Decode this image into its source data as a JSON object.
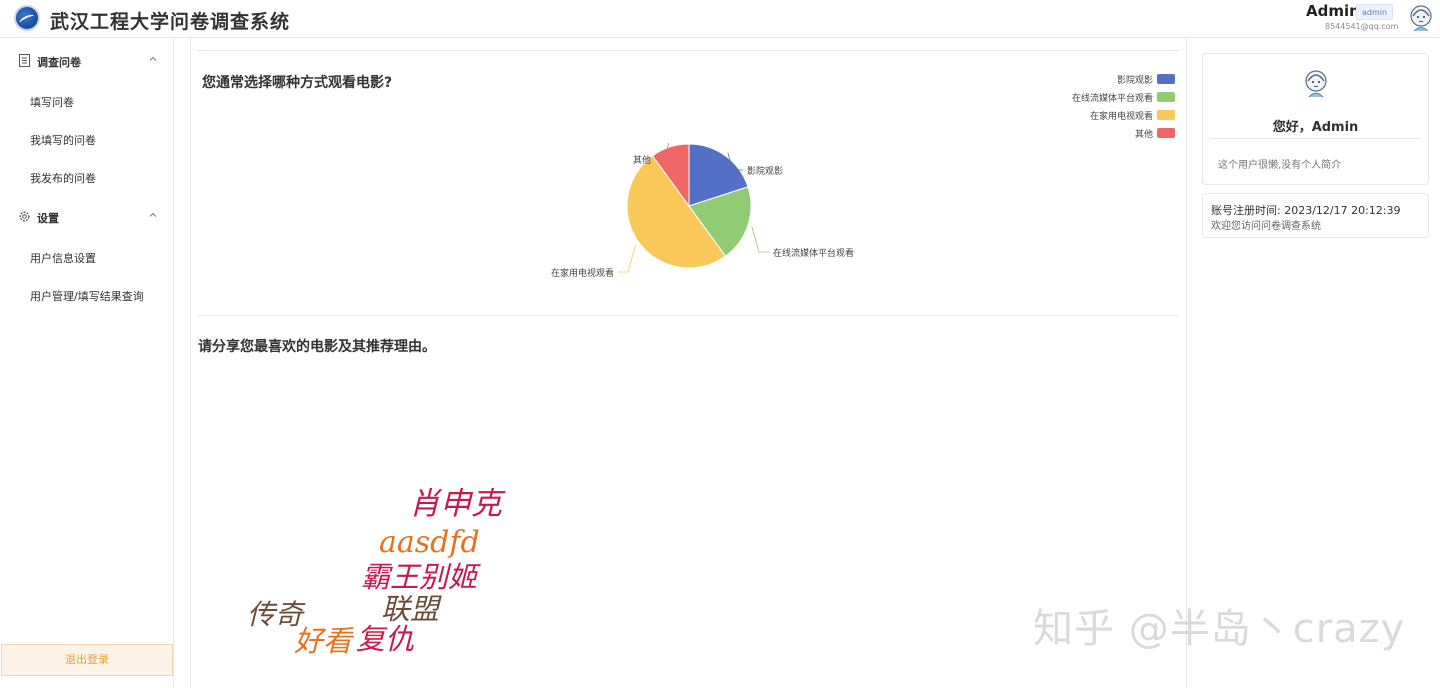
{
  "header": {
    "title": "武汉工程大学问卷调查系统",
    "user_name": "Admin",
    "user_role": "admin",
    "user_email": "8544541@qq.com"
  },
  "sidebar": {
    "groups": [
      {
        "label": "调查问卷",
        "icon": "document-icon",
        "items": [
          "填写问卷",
          "我填写的问卷",
          "我发布的问卷"
        ]
      },
      {
        "label": "设置",
        "icon": "gear-icon",
        "items": [
          "用户信息设置",
          "用户管理/填写结果查询"
        ]
      }
    ],
    "logout_label": "退出登录"
  },
  "main": {
    "q1_title": "您通常选择哪种方式观看电影?",
    "q2_title": "请分享您最喜欢的电影及其推荐理由。"
  },
  "chart_data": {
    "type": "pie",
    "categories": [
      "影院观影",
      "在线流媒体平台观看",
      "在家用电视观看",
      "其他"
    ],
    "values": [
      20,
      20,
      50,
      10
    ],
    "colors": [
      "#5470c6",
      "#91cc75",
      "#fac858",
      "#ee6666"
    ],
    "legend_position": "top-right"
  },
  "word_cloud": [
    {
      "text": "肖申克",
      "color": "#c9184a"
    },
    {
      "text": "aasdfd",
      "color": "#e8711c"
    },
    {
      "text": "霸王别姬",
      "color": "#c9184a"
    },
    {
      "text": "联盟",
      "color": "#6b4e3a"
    },
    {
      "text": "传奇",
      "color": "#6b4e3a"
    },
    {
      "text": "好看",
      "color": "#e8711c"
    },
    {
      "text": "复仇",
      "color": "#c9184a"
    }
  ],
  "profile": {
    "greeting": "您好，Admin",
    "bio": "这个用户很懒,没有个人简介",
    "register_time": "账号注册时间: 2023/12/17 20:12:39",
    "welcome": "欢迎您访问问卷调查系统"
  },
  "watermark": "知乎 @半岛丶crazy"
}
